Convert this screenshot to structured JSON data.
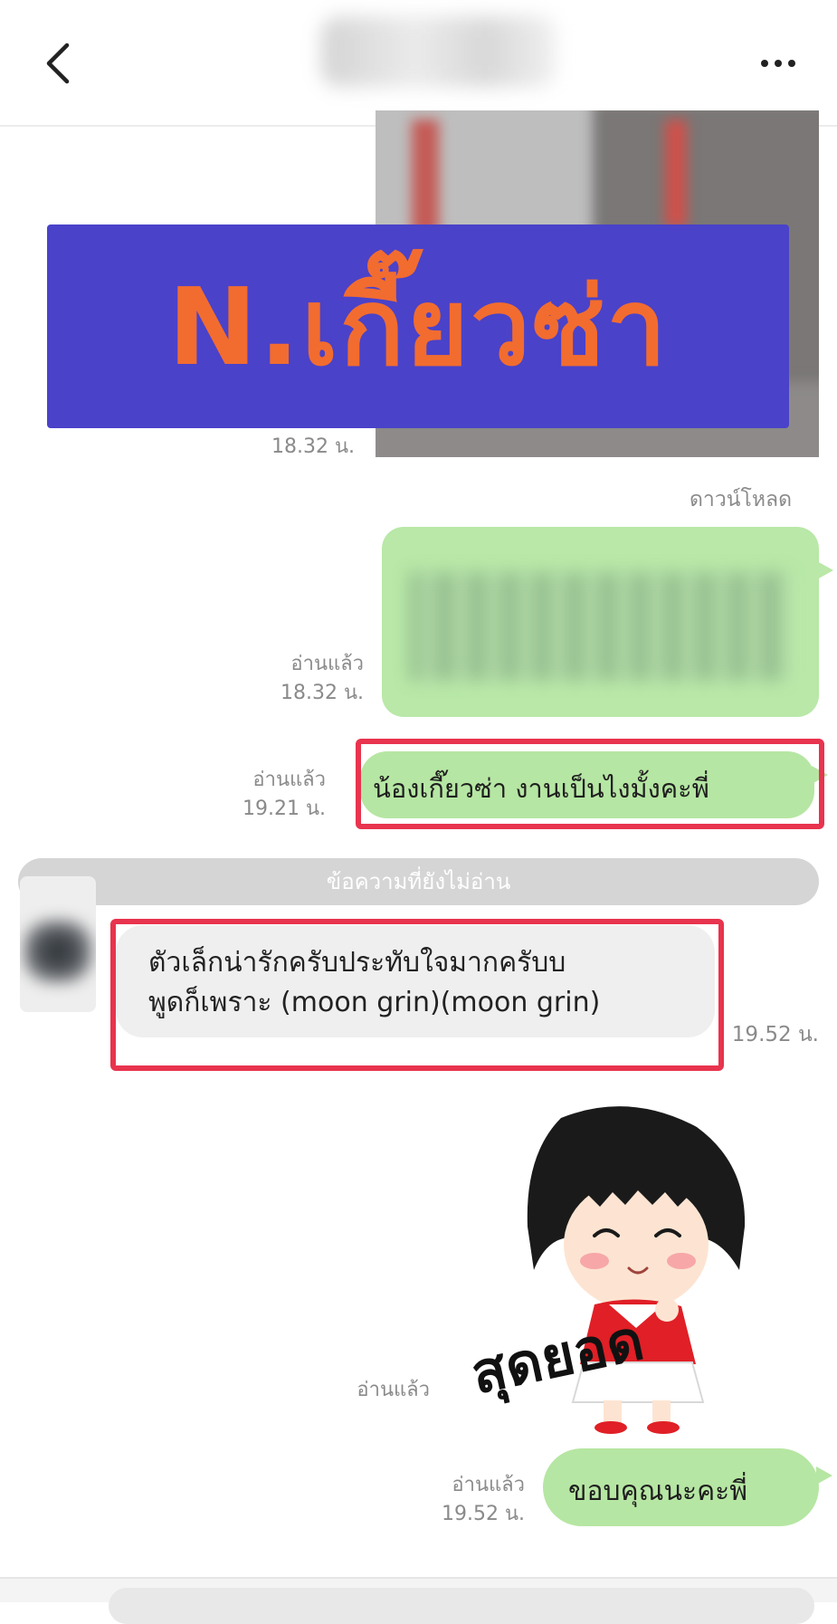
{
  "header": {
    "back_icon": "chevron-left-icon",
    "more_icon": "more-horizontal-icon"
  },
  "watermark": {
    "text": "N.เกี๊ยวซ่า",
    "background": "#4a42c9",
    "color": "#f26c2f"
  },
  "messages": {
    "photo_time": "18.32 น.",
    "download_label": "ดาวน์โหลด",
    "image_read": "อ่านแล้ว",
    "image_time": "18.32 น.",
    "msg1_read": "อ่านแล้ว",
    "msg1_time": "19.21 น.",
    "msg1_text": "น้องเกี๊ยวซ่า งานเป็นไงมั้งคะพี่",
    "unread_divider": "ข้อความที่ยังไม่อ่าน",
    "incoming_line1": "ตัวเล็กน่ารักครับประทับใจมากครับบ",
    "incoming_line2": "พูดก็เพราะ (moon grin)(moon grin)",
    "incoming_time": "19.52 น.",
    "sticker_read": "อ่านแล้ว",
    "sticker_text": "สุดยอด",
    "last_read": "อ่านแล้ว",
    "last_time": "19.52 น.",
    "last_text": "ขอบคุณนะคะพี่"
  },
  "colors": {
    "outgoing_bubble": "#b6e6a3",
    "incoming_bubble": "#efefef",
    "highlight": "#e8344e",
    "meta_text": "#8a8a8a"
  }
}
